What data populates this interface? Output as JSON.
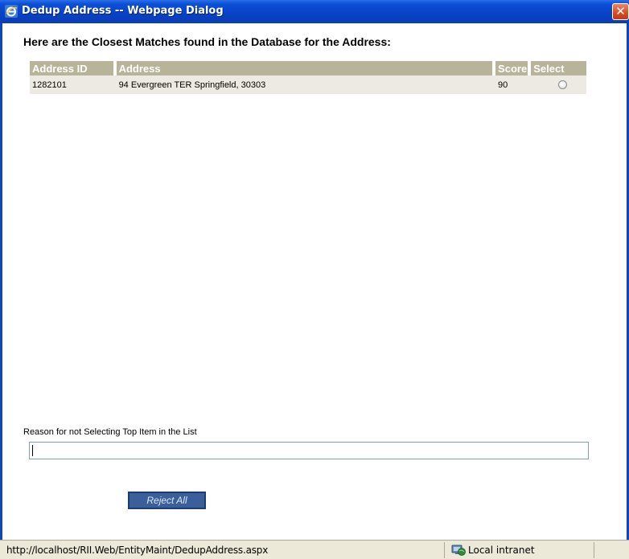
{
  "window": {
    "title": "Dedup Address -- Webpage Dialog",
    "close_symbol": "✕"
  },
  "heading": "Here are the Closest Matches found in the Database for the Address:",
  "table": {
    "columns": [
      "Address ID",
      "Address",
      "Score",
      "Select"
    ],
    "rows": [
      {
        "address_id": "1282101",
        "address": "94 Evergreen TER Springfield, 30303",
        "score": "90",
        "selected": false
      }
    ]
  },
  "reason": {
    "label": "Reason for not Selecting Top Item in the List",
    "value": ""
  },
  "reject_button": "Reject All",
  "statusbar": {
    "url": "http://localhost/RII.Web/EntityMaint/DedupAddress.aspx",
    "zone": "Local intranet"
  },
  "colors": {
    "titlebar": "#0a4fd6",
    "table_header": "#b7b49a",
    "table_row": "#eceae2",
    "button": "#3b5f9a"
  },
  "icons": [
    "ie-icon",
    "close-icon",
    "local-intranet-icon"
  ]
}
